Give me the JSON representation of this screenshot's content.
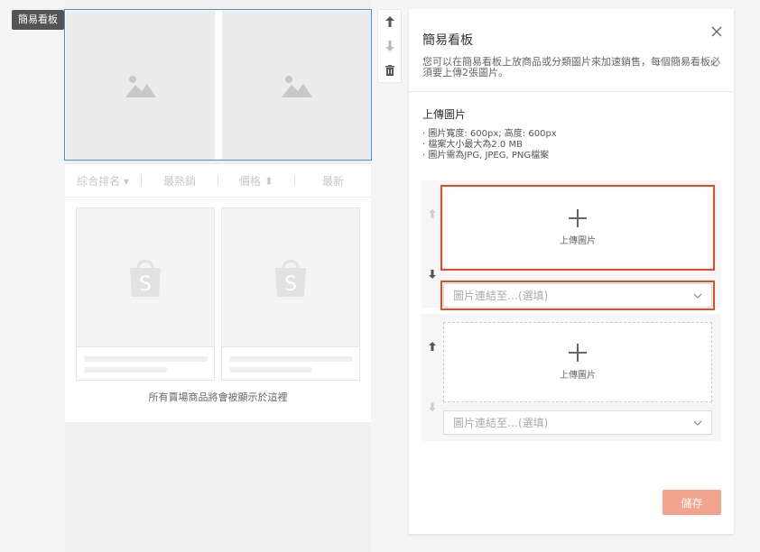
{
  "tag": {
    "label": "簡易看板"
  },
  "sorter": {
    "items": [
      "綜合排名",
      "最熱銷",
      "價格",
      "最新"
    ]
  },
  "products": {
    "note": "所有賣場商品將會被顯示於這裡"
  },
  "toolbar": {
    "icons": [
      "arrow-up-icon",
      "arrow-down-icon",
      "trash-icon"
    ]
  },
  "panel": {
    "title": "簡易看板",
    "description": "您可以在簡易看板上放商品或分類圖片來加速銷售，每個簡易看板必須要上傳2張圖片。",
    "section_title": "上傳圖片",
    "rules": [
      "· 圖片寬度: 600px; 高度: 600px",
      "· 檔案大小最大為2.0 MB",
      "· 圖片需為JPG, JPEG, PNG檔案"
    ],
    "blocks": [
      {
        "upload_label": "上傳圖片",
        "link_placeholder": "圖片連結至…(選填)"
      },
      {
        "upload_label": "上傳圖片",
        "link_placeholder": "圖片連結至…(選填)"
      }
    ],
    "save_label": "儲存"
  },
  "colors": {
    "accent": "#f3a48f",
    "highlight": "#d9502b",
    "selection": "#4a90d9"
  }
}
